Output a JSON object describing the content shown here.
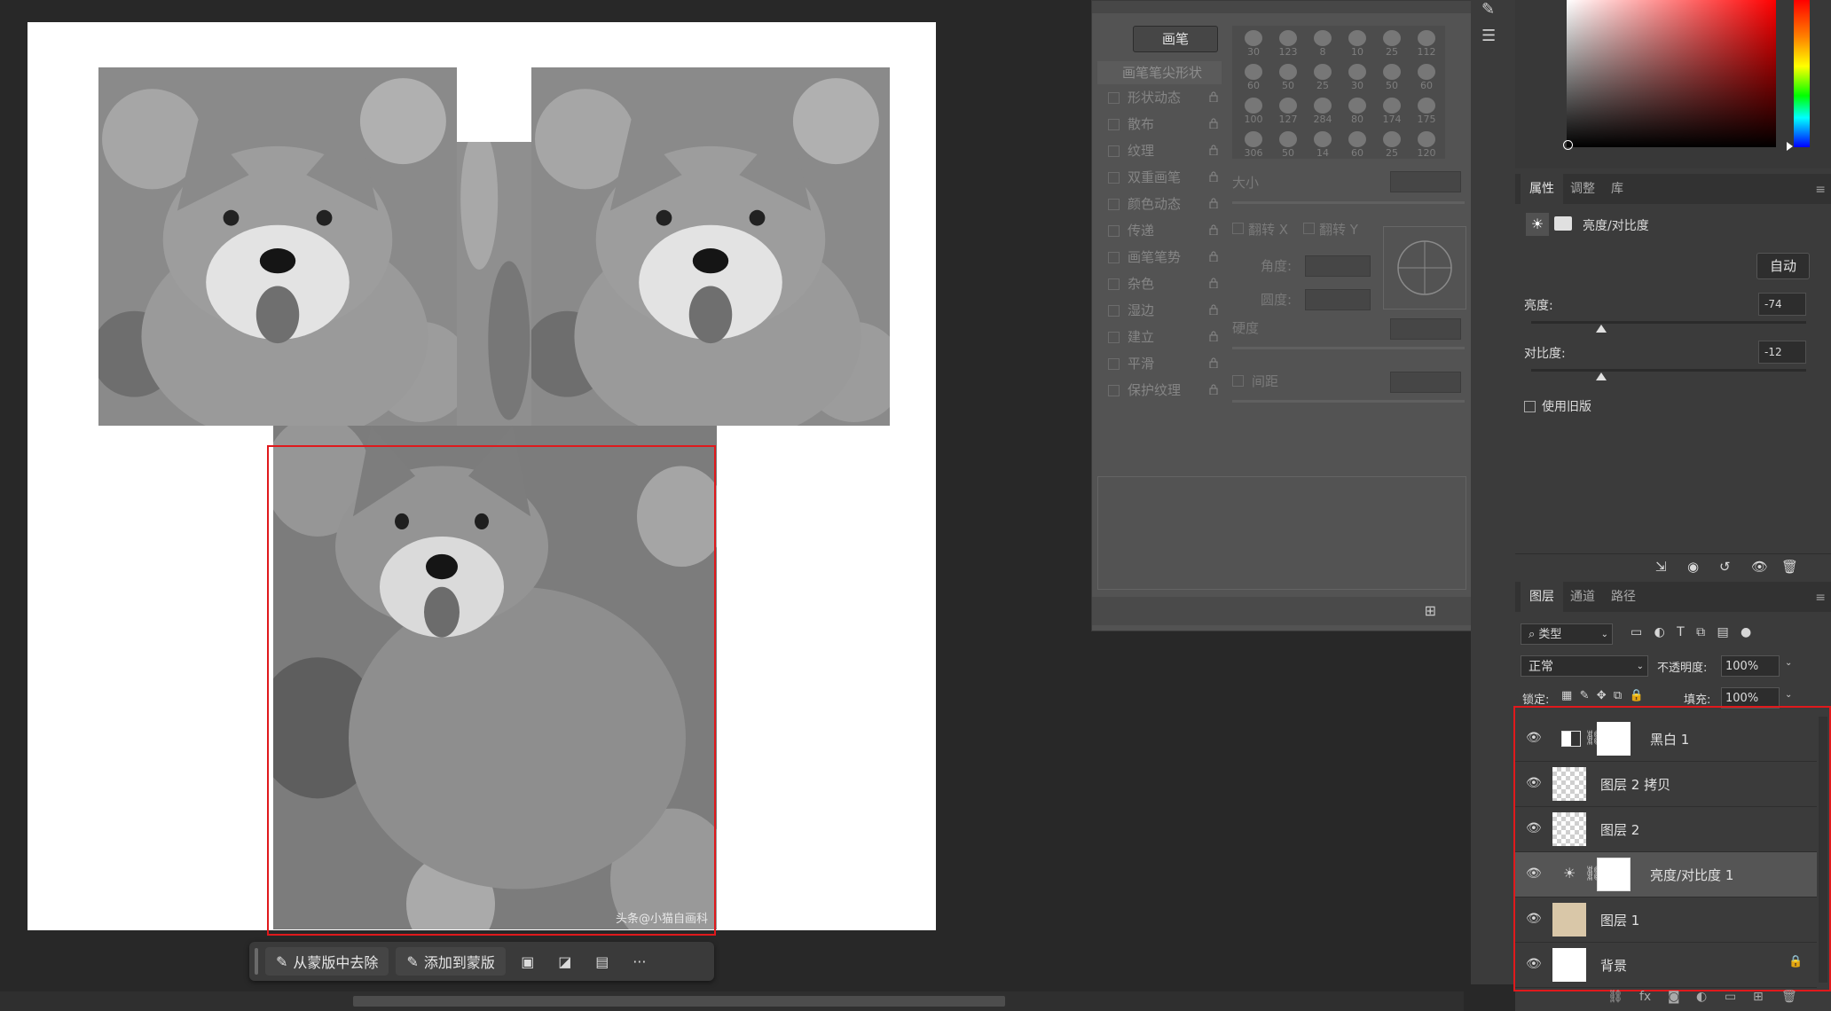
{
  "context_bar": {
    "subtract_label": "从蒙版中去除",
    "add_label": "添加到蒙版",
    "more_label": "···"
  },
  "canvas": {
    "watermark": "头条@小猫自画科"
  },
  "brush_panel": {
    "brushes_button": "画笔",
    "section_header": "画笔笔尖形状",
    "options": [
      "形状动态",
      "散布",
      "纹理",
      "双重画笔",
      "颜色动态",
      "传递",
      "画笔笔势",
      "杂色",
      "湿边",
      "建立",
      "平滑",
      "保护纹理"
    ],
    "tip_sizes": [
      "30",
      "123",
      "8",
      "10",
      "25",
      "112",
      "60",
      "50",
      "25",
      "30",
      "50",
      "60",
      "100",
      "127",
      "284",
      "80",
      "174",
      "175",
      "306",
      "50",
      "14",
      "60",
      "25",
      "120"
    ],
    "size_label": "大小",
    "flip_x_label": "翻转 X",
    "flip_y_label": "翻转 Y",
    "angle_label": "角度:",
    "roundness_label": "圆度:",
    "hardness_label": "硬度",
    "spacing_label": "间距"
  },
  "properties_panel": {
    "tabs": [
      "属性",
      "调整",
      "库"
    ],
    "title": "亮度/对比度",
    "auto_button": "自动",
    "brightness_label": "亮度:",
    "brightness_value": "-74",
    "brightness_level": -74,
    "contrast_label": "对比度:",
    "contrast_value": "-12",
    "contrast_level": -12,
    "legacy_label": "使用旧版"
  },
  "layers_panel": {
    "tabs": [
      "图层",
      "通道",
      "路径"
    ],
    "filter_label": "类型",
    "blend_mode": "正常",
    "opacity_label": "不透明度:",
    "opacity_value": "100%",
    "lock_label": "锁定:",
    "fill_label": "填充:",
    "fill_value": "100%",
    "layers": [
      {
        "name": "黑白 1",
        "type": "adjustment-bw"
      },
      {
        "name": "图层 2 拷贝",
        "type": "pixel"
      },
      {
        "name": "图层 2",
        "type": "pixel"
      },
      {
        "name": "亮度/对比度 1",
        "type": "adjustment-bc",
        "selected": true
      },
      {
        "name": "图层 1",
        "type": "pixel"
      },
      {
        "name": "背景",
        "type": "background"
      }
    ]
  },
  "colors": {
    "selection_red": "#e0191c",
    "panel_bg": "#3b3b3b",
    "canvas_bg": "#282828"
  }
}
